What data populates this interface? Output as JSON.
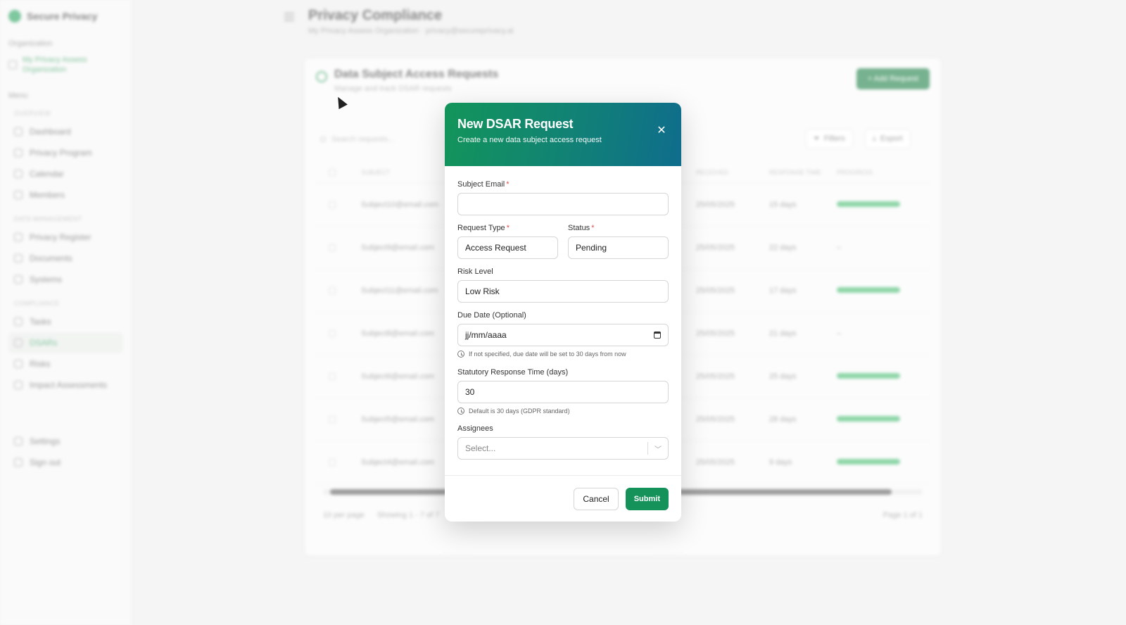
{
  "app": {
    "brand": "Secure Privacy",
    "page_title": "Privacy Compliance",
    "page_subtitle": "My Privacy Assess Organization · privacy@secureprivacy.ai",
    "org_section": "Organization",
    "org_name": "My Privacy Assess Organization",
    "menu_label": "Menu",
    "sidebar_groups": [
      {
        "label": "OVERVIEW",
        "items": [
          "Dashboard",
          "Privacy Program",
          "Calendar",
          "Members"
        ]
      },
      {
        "label": "DATA MANAGEMENT",
        "items": [
          "Privacy Register",
          "Documents",
          "Systems"
        ]
      },
      {
        "label": "COMPLIANCE",
        "items": [
          "Tasks",
          "DSARs",
          "Risks",
          "Impact Assessments"
        ]
      }
    ],
    "active_item": "DSARs",
    "sidebar_bottom": [
      "Settings",
      "Sign out"
    ]
  },
  "card": {
    "title": "Data Subject Access Requests",
    "subtitle": "Manage and track DSAR requests",
    "add_button": "+ Add Request",
    "search_placeholder": "Search requests...",
    "filters_label": "Filters",
    "export_label": "Export",
    "columns": [
      "",
      "SUBJECT",
      "RECEIVED",
      "RESPONSE TIME",
      "PROGRESS"
    ],
    "rows": [
      {
        "subject": "Subject10@email.com",
        "received": "25/05/2025",
        "response": "15 days",
        "progress": true
      },
      {
        "subject": "Subject9@email.com",
        "received": "25/05/2025",
        "response": "22 days",
        "progress": false
      },
      {
        "subject": "Subject11@email.com",
        "received": "25/05/2025",
        "response": "17 days",
        "progress": true
      },
      {
        "subject": "Subject8@email.com",
        "received": "25/05/2025",
        "response": "21 days",
        "progress": false
      },
      {
        "subject": "Subject6@email.com",
        "received": "25/05/2025",
        "response": "25 days",
        "progress": true
      },
      {
        "subject": "Subject5@email.com",
        "received": "25/05/2025",
        "response": "28 days",
        "progress": true
      },
      {
        "subject": "Subject4@email.com",
        "received": "25/05/2025",
        "response": "9 days",
        "progress": true
      }
    ],
    "rows_per_page": "10 per page",
    "showing": "Showing 1 - 7 of 7",
    "page": "Page 1 of 1"
  },
  "modal": {
    "title": "New DSAR Request",
    "subtitle": "Create a new data subject access request",
    "close_icon": "close-icon",
    "subject_email_label": "Subject Email",
    "subject_email_value": "",
    "request_type_label": "Request Type",
    "request_type_value": "Access Request",
    "status_label": "Status",
    "status_value": "Pending",
    "risk_level_label": "Risk Level",
    "risk_level_value": "Low Risk",
    "due_date_label": "Due Date (Optional)",
    "due_date_placeholder": "jj/mm/aaaa",
    "due_date_hint": "If not specified, due date will be set to 30 days from now",
    "response_time_label": "Statutory Response Time (days)",
    "response_time_value": "30",
    "response_time_hint": "Default is 30 days (GDPR standard)",
    "assignees_label": "Assignees",
    "assignees_placeholder": "Select...",
    "cancel_label": "Cancel",
    "submit_label": "Submit",
    "required_mark": "*"
  },
  "colors": {
    "accent": "#14925a",
    "header_gradient_start": "#13955a",
    "header_gradient_end": "#0f6d8c",
    "required": "#e05050"
  }
}
